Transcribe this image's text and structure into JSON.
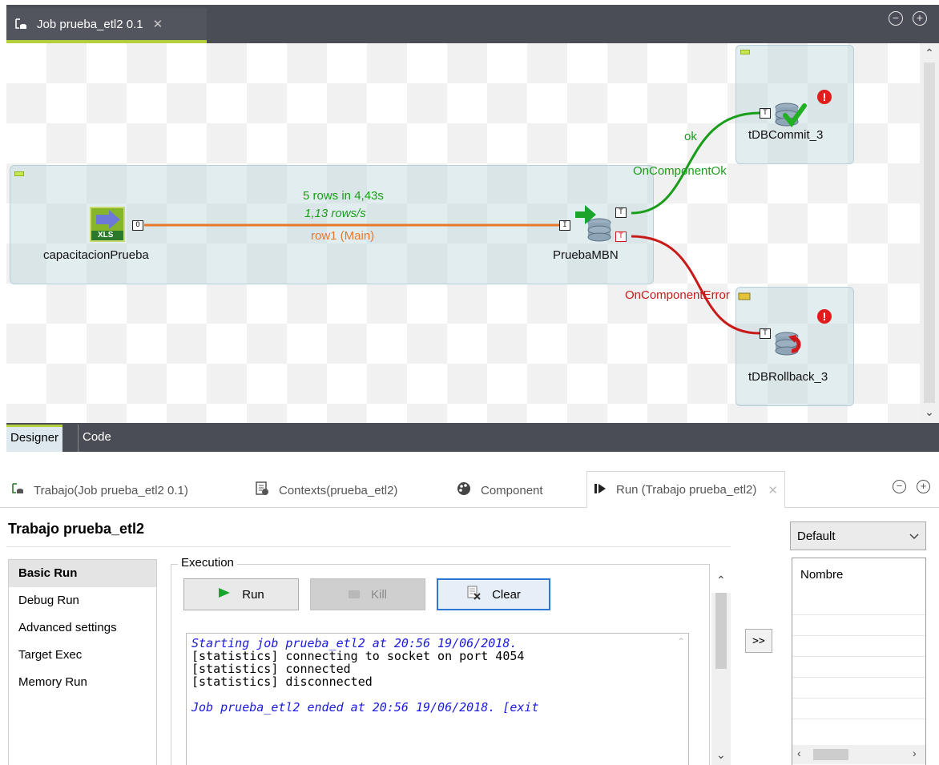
{
  "editor": {
    "tab_title": "Job prueba_etl2 0.1",
    "tab_close": "✕",
    "minimize": "−",
    "maximize": "+"
  },
  "canvas": {
    "components": {
      "input": {
        "label": "capacitacionPrueba",
        "icon": "xls-input-icon",
        "icon_text": "XLS",
        "port": "O"
      },
      "output": {
        "label": "PruebaMBN",
        "icon": "db-output-icon",
        "port_in": "I",
        "port_ok": "T",
        "port_err": "T"
      },
      "commit": {
        "label": "tDBCommit_3",
        "icon": "db-commit-icon",
        "port": "T"
      },
      "rollback": {
        "label": "tDBRollback_3",
        "icon": "db-rollback-icon",
        "port": "T"
      }
    },
    "flow": {
      "stats_rows": "5 rows in 4,43s",
      "stats_rate": "1,13 rows/s",
      "main_label": "row1 (Main)",
      "ok_label": "ok",
      "on_ok_label": "OnComponentOk",
      "on_error_label": "OnComponentError"
    },
    "colors": {
      "main_link": "#e6782c",
      "ok_link": "#1a9d1a",
      "error_link": "#c91a1a"
    }
  },
  "view_tabs": {
    "designer": "Designer",
    "code": "Code"
  },
  "bottom_tabs": {
    "job": "Trabajo(Job prueba_etl2 0.1)",
    "contexts": "Contexts(prueba_etl2)",
    "component": "Component",
    "run": "Run (Trabajo prueba_etl2)",
    "close": "✕"
  },
  "run_panel": {
    "title": "Trabajo prueba_etl2",
    "nav": [
      "Basic Run",
      "Debug Run",
      "Advanced settings",
      "Target Exec",
      "Memory Run"
    ],
    "execution_legend": "Execution",
    "buttons": {
      "run": "Run",
      "kill": "Kill",
      "clear": "Clear"
    },
    "console": {
      "start": "Starting job prueba_etl2 at 20:56 19/06/2018.",
      "line1": "[statistics] connecting to socket on port 4054",
      "line2": "[statistics] connected",
      "line3": "[statistics] disconnected",
      "end": "Job prueba_etl2 ended at 20:56 19/06/2018. [exit"
    },
    "move_button": ">>"
  },
  "context_panel": {
    "selected": "Default",
    "column": "Nombre"
  }
}
